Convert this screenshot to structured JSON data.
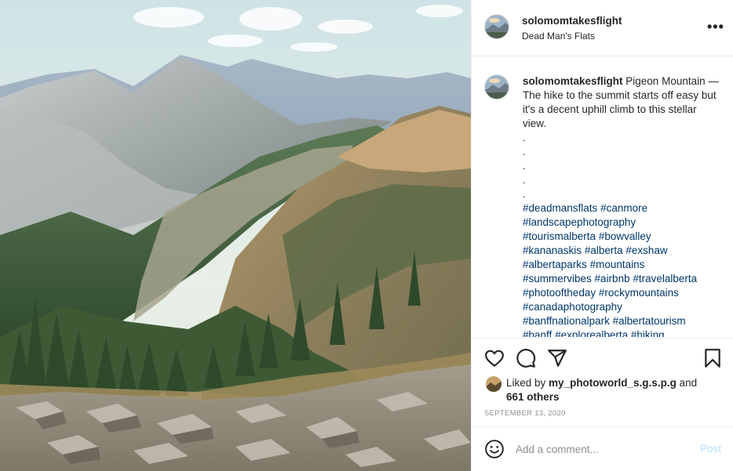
{
  "post": {
    "username": "solomomtakesflight",
    "location": "Dead Man's Flats"
  },
  "caption": {
    "username": "solomomtakesflight",
    "text": " Pigeon Mountain — The hike to the summit starts off easy but it's a decent uphill climb to this stellar view.",
    "dots": [
      ".",
      ".",
      ".",
      ".",
      "."
    ],
    "hashtag_lines": [
      [
        "#deadmansflats",
        "#canmore"
      ],
      [
        "#landscapephotography"
      ],
      [
        "#tourismalberta",
        "#bowvalley"
      ],
      [
        "#kananaskis",
        "#alberta",
        "#exshaw"
      ],
      [
        "#albertaparks",
        "#mountains"
      ],
      [
        "#summervibes",
        "#airbnb",
        "#travelalberta"
      ],
      [
        "#photooftheday",
        "#rockymountains"
      ],
      [
        "#canadaphotography"
      ],
      [
        "#banffnationalpark",
        "#albertatourism"
      ],
      [
        "#banff",
        "#explorealberta",
        "#hiking"
      ]
    ]
  },
  "likes": {
    "prefix": "Liked by ",
    "user": "my_photoworld_s.g.s.p.g",
    "and": " and",
    "others": "661 others"
  },
  "date": "September 13, 2020",
  "add_comment": {
    "placeholder": "Add a comment...",
    "post_label": "Post"
  },
  "icons": {
    "more": "more-horizontal-icon",
    "like": "heart-icon",
    "comment": "comment-bubble-icon",
    "share": "paper-plane-icon",
    "save": "bookmark-icon",
    "emoji": "smiley-icon"
  },
  "colors": {
    "hashtag": "#00376b",
    "post_disabled": "#b2dffc",
    "meta_gray": "#8e8e8e"
  }
}
